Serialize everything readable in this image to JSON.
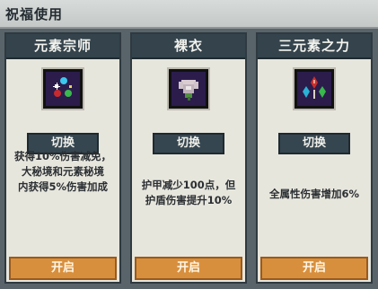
{
  "header": {
    "title": "祝福使用"
  },
  "cards": [
    {
      "name": "元素宗师",
      "icon": "element-orbs-icon",
      "switch_label": "切换",
      "desc_lines": [
        "获得10%伤害减免，",
        "大秘境和元素秘境",
        "内获得5%伤害加成"
      ],
      "activate_label": "开启"
    },
    {
      "name": "裸衣",
      "icon": "bare-robe-icon",
      "switch_label": "切换",
      "desc_lines": [
        "护甲减少100点，但",
        "护盾伤害提升10%"
      ],
      "activate_label": "开启"
    },
    {
      "name": "三元素之力",
      "icon": "three-crystals-icon",
      "switch_label": "切换",
      "desc_lines": [
        "全属性伤害增加6%"
      ],
      "activate_label": "开启"
    }
  ],
  "colors": {
    "header_bg": "#c9cecc",
    "card_bg": "#e7e6dd",
    "card_title_bg": "#34434c",
    "switch_bg": "#364650",
    "activate_bg": "#d88f3d"
  }
}
